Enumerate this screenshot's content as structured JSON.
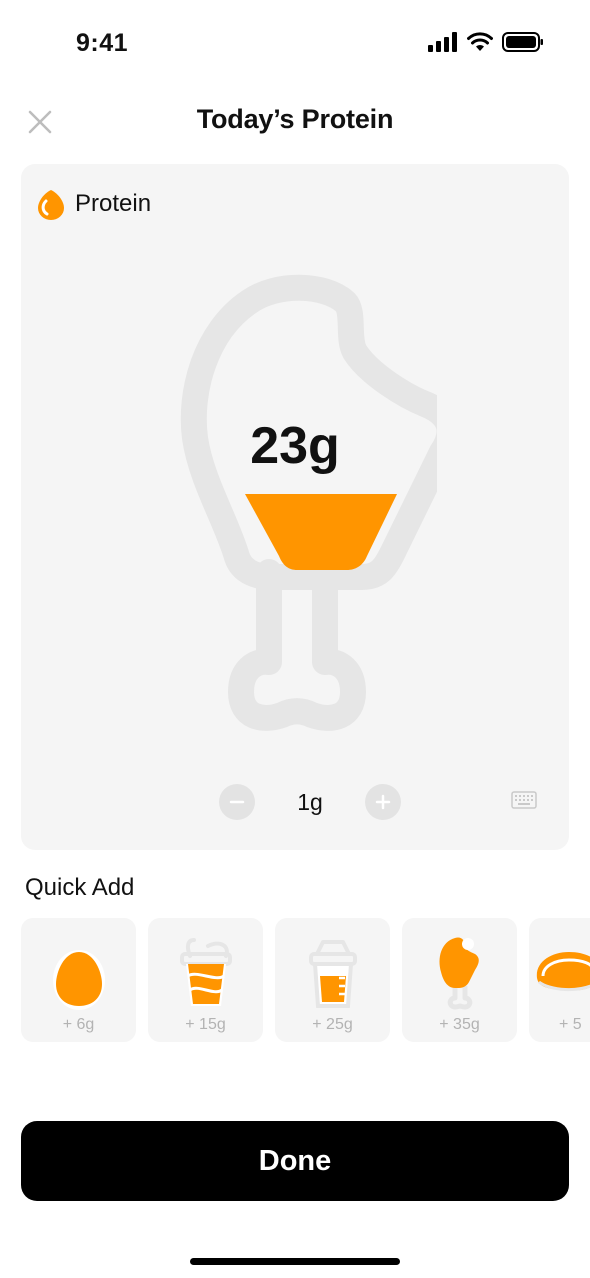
{
  "status_bar": {
    "time": "9:41",
    "icons": [
      "signal-icon",
      "wifi-icon",
      "battery-icon"
    ]
  },
  "nav": {
    "title": "Today’s Protein",
    "close_icon": "close-icon"
  },
  "tracker": {
    "title": "Protein",
    "icon": "protein-drop-icon",
    "total": "23g",
    "fill_fraction": 0.3,
    "step_value": "1g",
    "decrement_icon": "minus-icon",
    "increment_icon": "plus-icon",
    "keyboard_icon": "keyboard-icon"
  },
  "quick_add": {
    "title": "Quick Add",
    "items": [
      {
        "label": "+ 6g",
        "icon": "egg-icon"
      },
      {
        "label": "+ 15g",
        "icon": "yogurt-cup-icon"
      },
      {
        "label": "+ 25g",
        "icon": "protein-shake-icon"
      },
      {
        "label": "+ 35g",
        "icon": "drumstick-icon"
      },
      {
        "label": "+ 5",
        "icon": "steak-icon"
      }
    ]
  },
  "done_label": "Done",
  "colors": {
    "accent": "#FF9500",
    "card_background": "#F5F5F5",
    "outline_gray": "#E6E6E6",
    "button_background": "#000000"
  }
}
